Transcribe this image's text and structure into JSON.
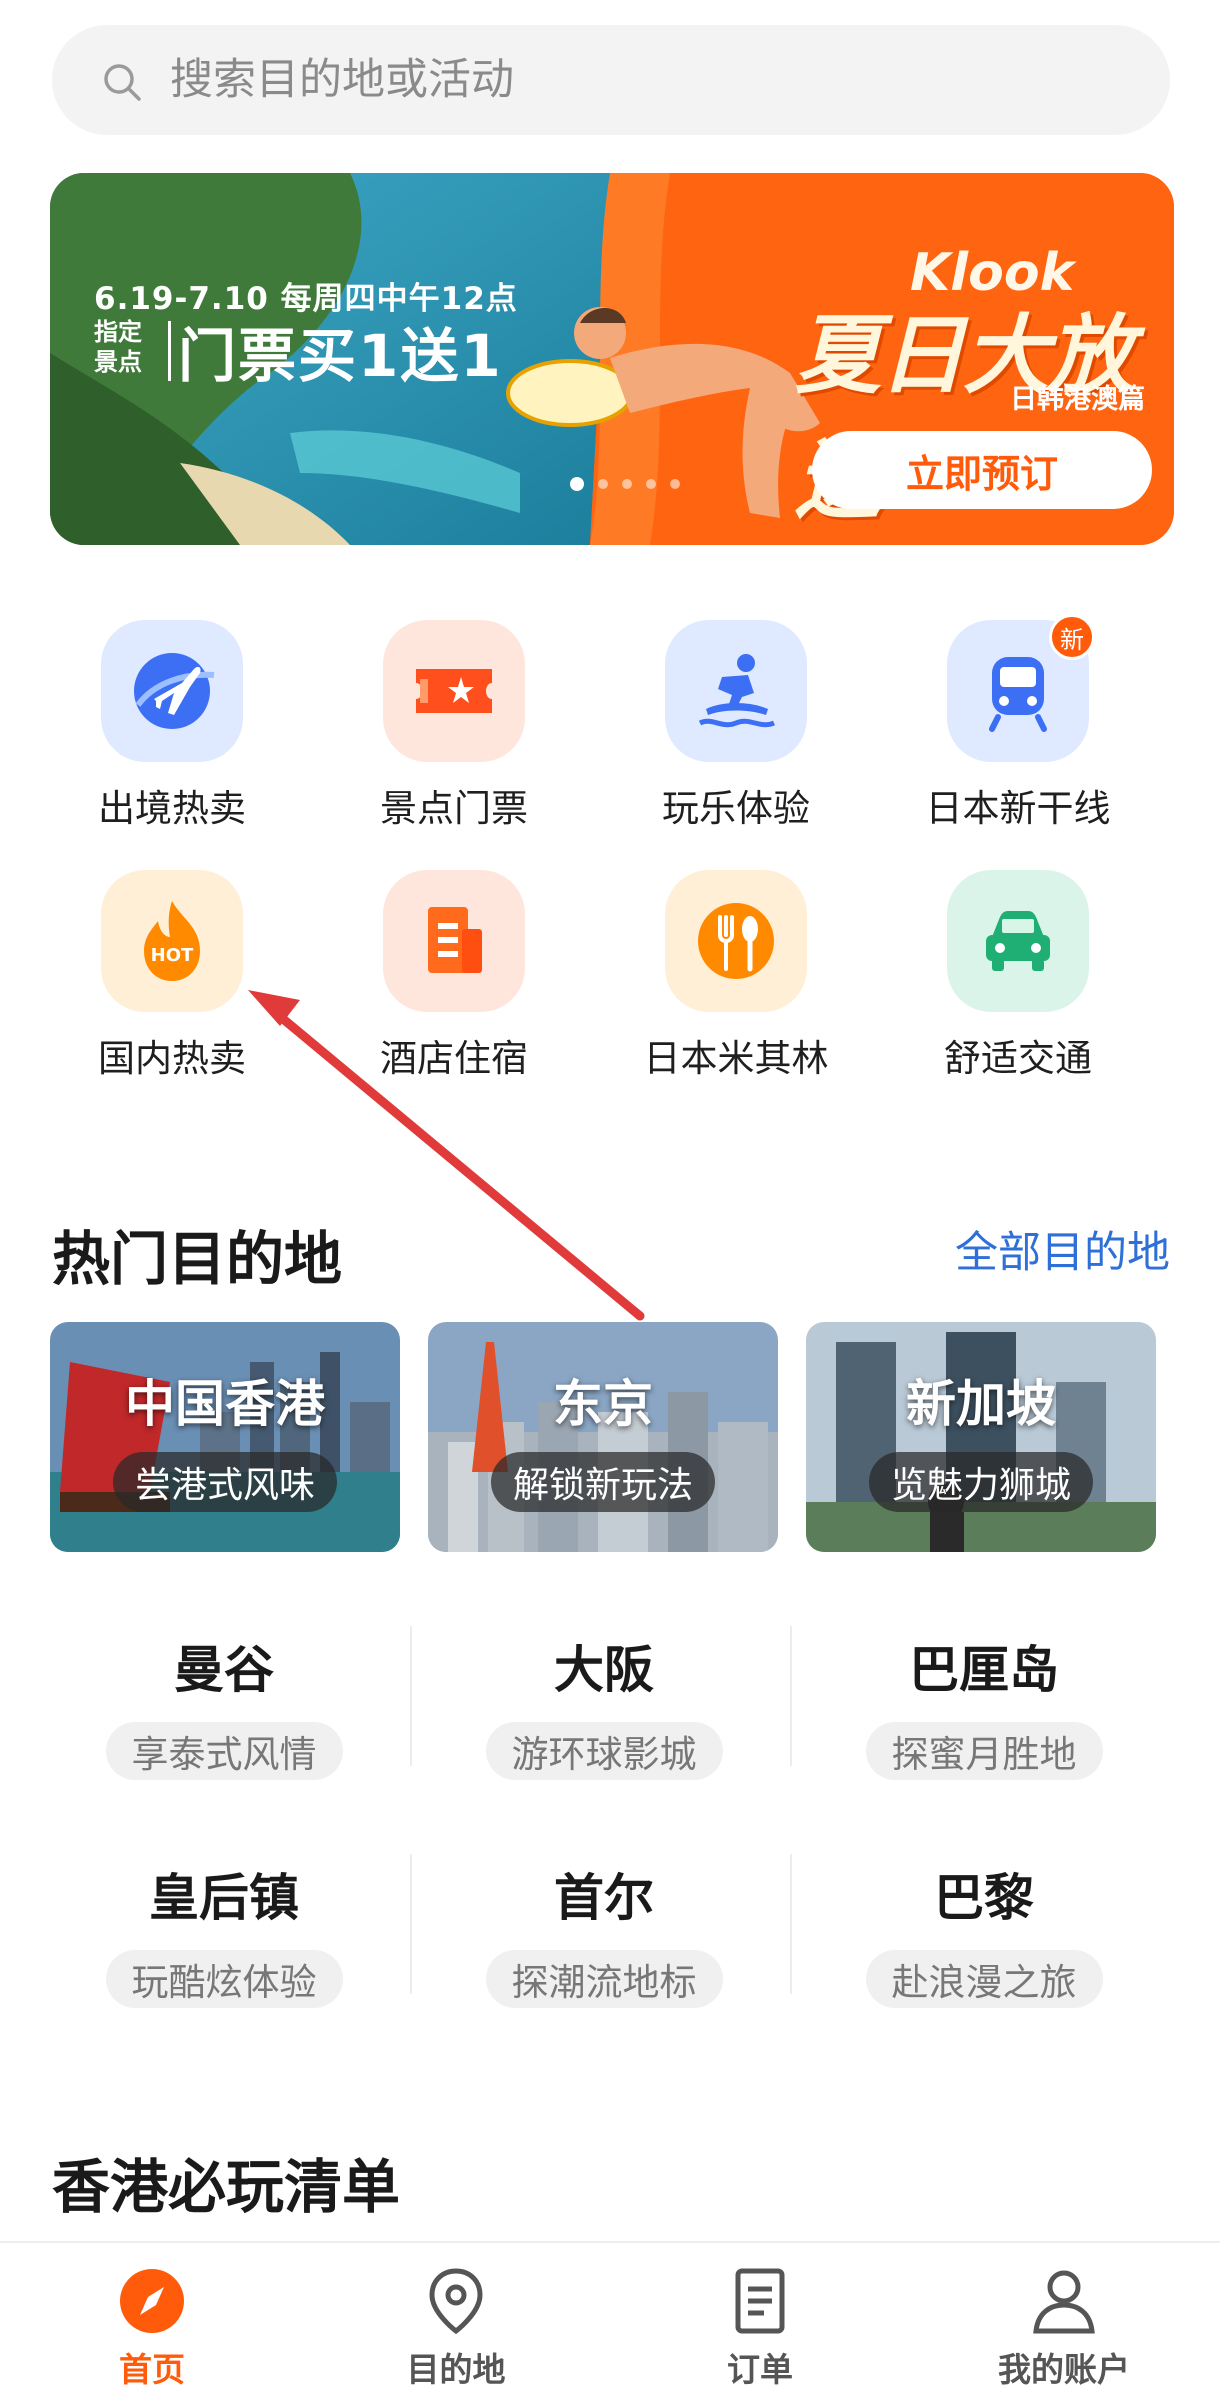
{
  "search": {
    "placeholder": "搜索目的地或活动",
    "icon": "search-icon"
  },
  "banner": {
    "dates": "6.19-7.10 每周四中午12点",
    "small_line1": "指定",
    "small_line2": "景点",
    "promo": "门票买1送1",
    "brand": "Klook",
    "campaign": "夏日大放送",
    "sub": "日韩港澳篇",
    "cta": "立即预订",
    "slides_total": 5,
    "active_slide": 1
  },
  "categories": [
    {
      "label": "出境热卖",
      "icon": "airplane-globe-icon",
      "bg": "#dfe9ff"
    },
    {
      "label": "景点门票",
      "icon": "ticket-icon",
      "bg": "#ffe6dc"
    },
    {
      "label": "玩乐体验",
      "icon": "surfer-icon",
      "bg": "#dfe9ff"
    },
    {
      "label": "日本新干线",
      "icon": "train-icon",
      "bg": "#dfe9ff",
      "badge": "新"
    },
    {
      "label": "国内热卖",
      "icon": "hot-flame-icon",
      "bg": "#ffefd6",
      "badge_text": "HOT"
    },
    {
      "label": "酒店住宿",
      "icon": "hotel-icon",
      "bg": "#ffe6dc"
    },
    {
      "label": "日本米其林",
      "icon": "fork-spoon-icon",
      "bg": "#ffefd6"
    },
    {
      "label": "舒适交通",
      "icon": "car-icon",
      "bg": "#daf4ea"
    }
  ],
  "hot_destinations": {
    "title": "热门目的地",
    "see_all": "全部目的地",
    "cards": [
      {
        "name": "中国香港",
        "tag": "尝港式风味"
      },
      {
        "name": "东京",
        "tag": "解锁新玩法"
      },
      {
        "name": "新加坡",
        "tag": "览魅力狮城"
      }
    ],
    "cities": [
      {
        "name": "曼谷",
        "tag": "享泰式风情"
      },
      {
        "name": "大阪",
        "tag": "游环球影城"
      },
      {
        "name": "巴厘岛",
        "tag": "探蜜月胜地"
      },
      {
        "name": "皇后镇",
        "tag": "玩酷炫体验"
      },
      {
        "name": "首尔",
        "tag": "探潮流地标"
      },
      {
        "name": "巴黎",
        "tag": "赴浪漫之旅"
      }
    ]
  },
  "hk_section": {
    "title": "香港必玩清单"
  },
  "tabs": [
    {
      "label": "首页",
      "icon": "compass-icon",
      "active": true
    },
    {
      "label": "目的地",
      "icon": "location-pin-icon",
      "active": false
    },
    {
      "label": "订单",
      "icon": "document-icon",
      "active": false
    },
    {
      "label": "我的账户",
      "icon": "user-icon",
      "active": false
    }
  ],
  "colors": {
    "accent": "#ff5b0a",
    "link": "#2f6fd8",
    "annotation_arrow": "#e03a3a"
  }
}
